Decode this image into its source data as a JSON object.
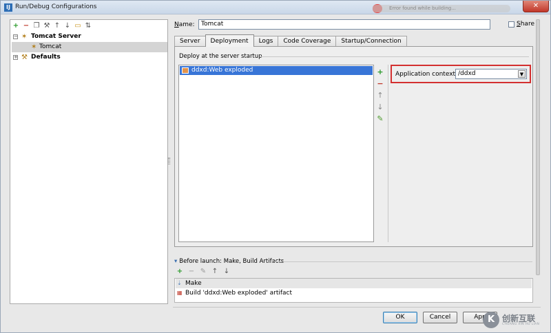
{
  "window": {
    "title": "Run/Debug Configurations",
    "icon_label": "IJ"
  },
  "notification": {
    "text": "Error found while building..."
  },
  "left_toolbar": {
    "icons": [
      "add-icon",
      "remove-icon",
      "copy-icon",
      "wrench-icon",
      "move-up-icon",
      "move-down-icon",
      "folder-icon",
      "sort-icon"
    ]
  },
  "tree": {
    "items": [
      {
        "label": "Tomcat Server",
        "bold": true,
        "expanded": true
      },
      {
        "label": "Tomcat",
        "bold": false,
        "selected": true
      },
      {
        "label": "Defaults",
        "bold": true,
        "expanded": false
      }
    ]
  },
  "name_field": {
    "label_underlined": "N",
    "label_rest": "ame:",
    "value": "Tomcat"
  },
  "share": {
    "label_underlined": "S",
    "label_rest": "hare",
    "checked": false
  },
  "tabs": [
    {
      "label": "Server",
      "active": false
    },
    {
      "label": "Deployment",
      "active": true
    },
    {
      "label": "Logs",
      "active": false
    },
    {
      "label": "Code Coverage",
      "active": false
    },
    {
      "label": "Startup/Connection",
      "active": false
    }
  ],
  "deployment": {
    "section_title": "Deploy at the server startup",
    "items": [
      "ddxd:Web exploded"
    ],
    "side_tools": [
      "add-icon",
      "remove-icon",
      "move-up-icon",
      "move-down-icon",
      "edit-icon"
    ],
    "context_label": "Application context:",
    "context_value": "/ddxd",
    "highlight_color": "#d32f2f"
  },
  "before_launch": {
    "title": "Before launch: Make, Build Artifacts",
    "toolbar": [
      "add-icon",
      "remove-icon",
      "edit-icon",
      "move-up-icon",
      "move-down-icon"
    ],
    "items": [
      "Make",
      "Build 'ddxd:Web exploded' artifact"
    ]
  },
  "buttons": {
    "ok": "OK",
    "cancel": "Cancel",
    "apply": "App"
  },
  "watermark": {
    "logo": "K",
    "text": "创新互联",
    "sub": "CHUANG XIN HU LIAN"
  }
}
